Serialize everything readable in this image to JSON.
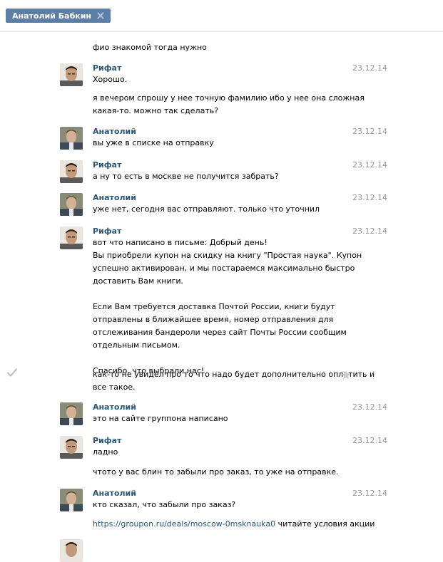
{
  "header": {
    "tab_title": "Анатолий Бабкин"
  },
  "colors": {
    "tab_bg": "#5b7fa6",
    "author": "#2b587a",
    "date": "#999999",
    "link": "#2b587a"
  },
  "messages": [
    {
      "lines": [
        "фио знакомой тогда нужно"
      ]
    },
    {
      "author": "Рифат",
      "date": "23.12.14",
      "lines": [
        "Хорошо."
      ]
    },
    {
      "lines": [
        "я вечером спрошу у нее точную фамилию ибо у нее она сложная",
        "какая-то. можно так сделать?"
      ]
    },
    {
      "author": "Анатолий",
      "date": "23.12.14",
      "lines": [
        "вы уже в списке на отправку"
      ]
    },
    {
      "author": "Рифат",
      "date": "23.12.14",
      "lines": [
        "а ну то есть в москве не получится забрать?"
      ]
    },
    {
      "author": "Анатолий",
      "date": "23.12.14",
      "lines": [
        "уже нет, сегодня вас отправляют. только что уточнил"
      ]
    },
    {
      "author": "Рифат",
      "date": "23.12.14",
      "lines": [
        "вот что написано в письме: Добрый день!",
        "Вы приобрели купон на скидку на книгу \"Простая наука\". Купон",
        "успешно активирован, и мы постараемся максимально быстро",
        "доставить Вам книги.",
        "",
        "Если Вам требуется доставка Почтой России, книги будут",
        "отправлены в ближайшее время, номер отправления для",
        "отслеживания бандероли через сайт Почты России сообщим",
        "отдельным письмом.",
        "",
        "Спасибо, что выбрали нас!"
      ]
    },
    {
      "lines": [
        "как-то не увидел про то что надо будет дополнительно оплатить и",
        "все такое."
      ]
    },
    {
      "author": "Анатолий",
      "date": "23.12.14",
      "lines": [
        "это на сайте группона написано"
      ]
    },
    {
      "author": "Рифат",
      "date": "23.12.14",
      "lines": [
        "ладно"
      ]
    },
    {
      "lines": [
        "чтото у вас блин то забыли про заказ, то уже на отправке."
      ]
    },
    {
      "author": "Анатолий",
      "date": "23.12.14",
      "lines": [
        "кто сказал, что забыли про заказ?"
      ]
    },
    {
      "link": "https://groupon.ru/deals/moscow-0msknauka0",
      "after_link": " читайте условия акции"
    }
  ]
}
